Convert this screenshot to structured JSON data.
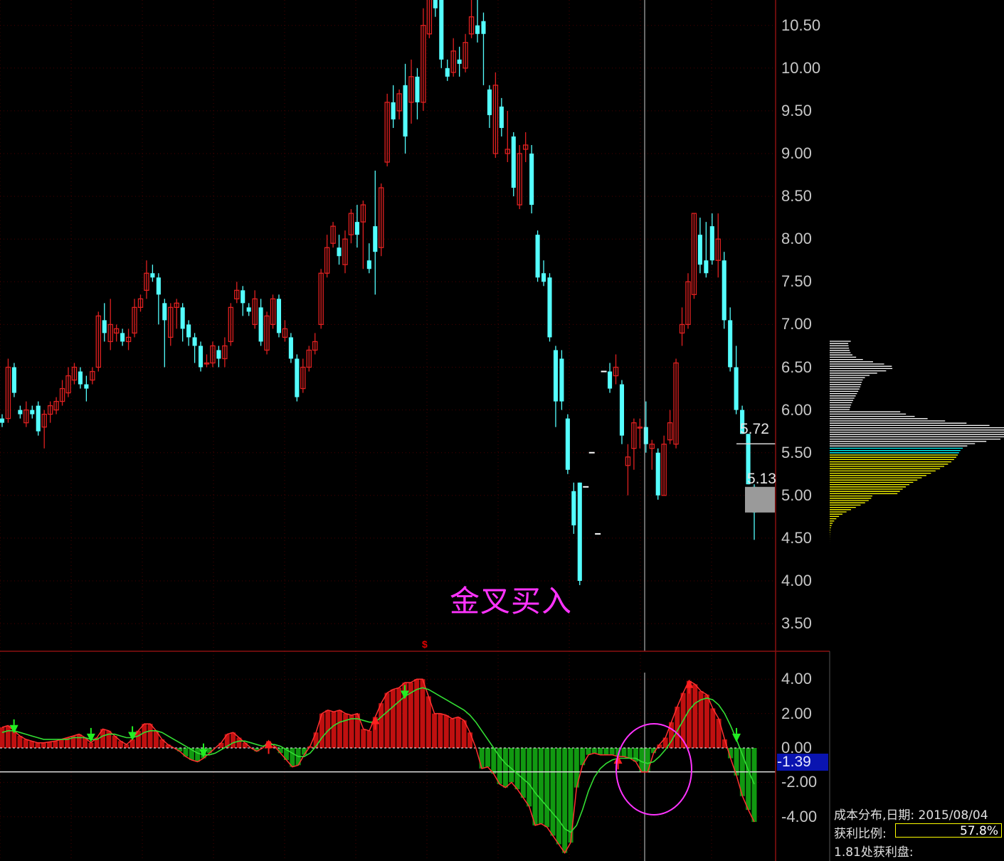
{
  "window": {
    "title": ""
  },
  "annotation": {
    "text": "金叉买入",
    "color": "#ff33ff"
  },
  "price_marker": {
    "text": "$"
  },
  "price_tags": {
    "high": "5.72",
    "last": "5.13"
  },
  "macd_current": {
    "value": "-1.39"
  },
  "cost_distribution": {
    "title": "成本分布,日期: 2015/08/04",
    "profit_label": "获利比例:",
    "profit_value": "57.8%",
    "profit_count": "1.81处获利盘:"
  },
  "colors": {
    "up": "#e02020",
    "down": "#54ffff",
    "macd_pos": "#c01010",
    "macd_neg": "#119911",
    "signal_line": "#33dd33",
    "grid": "#4a0000",
    "axis_text": "#c8c8c8"
  },
  "chart_data": [
    {
      "type": "candlestick",
      "title": "",
      "y_ticks": [
        "10.50",
        "10.00",
        "9.50",
        "9.00",
        "8.50",
        "8.00",
        "7.50",
        "7.00",
        "6.50",
        "6.00",
        "5.50",
        "5.00",
        "4.50",
        "4.00",
        "3.50"
      ],
      "ylim": [
        3.3,
        10.8
      ],
      "candles": [
        [
          5.9,
          5.85,
          5.95,
          5.8
        ],
        [
          5.9,
          6.5,
          6.6,
          5.85
        ],
        [
          6.5,
          6.2,
          6.55,
          6.15
        ],
        [
          6.0,
          5.95,
          6.05,
          5.9
        ],
        [
          5.85,
          6.0,
          6.1,
          5.8
        ],
        [
          6.0,
          5.95,
          6.05,
          5.9
        ],
        [
          6.05,
          5.75,
          6.1,
          5.7
        ],
        [
          5.8,
          5.95,
          6.0,
          5.55
        ],
        [
          5.95,
          6.05,
          6.1,
          5.85
        ],
        [
          6.0,
          6.1,
          6.15,
          5.95
        ],
        [
          6.1,
          6.25,
          6.35,
          6.05
        ],
        [
          6.2,
          6.4,
          6.5,
          6.15
        ],
        [
          6.35,
          6.5,
          6.55,
          6.3
        ],
        [
          6.45,
          6.3,
          6.5,
          6.25
        ],
        [
          6.3,
          6.25,
          6.4,
          6.1
        ],
        [
          6.35,
          6.45,
          6.5,
          6.3
        ],
        [
          6.5,
          7.1,
          7.15,
          6.45
        ],
        [
          7.05,
          6.9,
          7.25,
          6.8
        ],
        [
          6.8,
          7.0,
          7.3,
          6.7
        ],
        [
          6.9,
          6.95,
          7.0,
          6.8
        ],
        [
          6.9,
          6.8,
          6.95,
          6.75
        ],
        [
          6.8,
          6.85,
          6.95,
          6.7
        ],
        [
          6.9,
          7.2,
          7.3,
          6.85
        ],
        [
          7.2,
          7.3,
          7.35,
          7.15
        ],
        [
          7.4,
          7.6,
          7.75,
          7.3
        ],
        [
          7.6,
          7.55,
          7.7,
          7.5
        ],
        [
          7.55,
          7.35,
          7.6,
          7.0
        ],
        [
          7.25,
          7.05,
          7.3,
          6.5
        ],
        [
          6.85,
          7.2,
          7.25,
          6.75
        ],
        [
          7.2,
          7.25,
          7.3,
          6.95
        ],
        [
          7.2,
          6.95,
          7.25,
          6.8
        ],
        [
          7.0,
          6.85,
          7.05,
          6.75
        ],
        [
          6.85,
          6.75,
          6.9,
          6.55
        ],
        [
          6.75,
          6.5,
          6.8,
          6.45
        ],
        [
          6.55,
          6.55,
          6.65,
          6.5
        ],
        [
          6.55,
          6.75,
          6.8,
          6.5
        ],
        [
          6.7,
          6.6,
          6.75,
          6.5
        ],
        [
          6.6,
          6.75,
          6.85,
          6.5
        ],
        [
          6.8,
          7.2,
          7.25,
          6.75
        ],
        [
          7.3,
          7.4,
          7.5,
          7.25
        ],
        [
          7.4,
          7.25,
          7.45,
          7.1
        ],
        [
          7.2,
          7.15,
          7.25,
          7.1
        ],
        [
          7.0,
          7.3,
          7.4,
          6.95
        ],
        [
          7.2,
          6.8,
          7.3,
          6.75
        ],
        [
          6.7,
          7.1,
          7.15,
          6.65
        ],
        [
          7.0,
          7.3,
          7.35,
          6.95
        ],
        [
          7.3,
          6.9,
          7.35,
          6.85
        ],
        [
          6.85,
          6.95,
          7.05,
          6.8
        ],
        [
          6.85,
          6.6,
          6.9,
          6.55
        ],
        [
          6.6,
          6.15,
          6.65,
          6.1
        ],
        [
          6.25,
          6.5,
          6.6,
          6.2
        ],
        [
          6.5,
          6.7,
          6.75,
          6.45
        ],
        [
          6.7,
          6.8,
          6.9,
          6.65
        ],
        [
          7.0,
          7.6,
          7.65,
          6.95
        ],
        [
          7.6,
          7.9,
          8.05,
          7.55
        ],
        [
          7.95,
          8.15,
          8.2,
          7.9
        ],
        [
          7.9,
          7.8,
          8.05,
          7.7
        ],
        [
          7.7,
          8.0,
          8.1,
          7.6
        ],
        [
          8.05,
          8.3,
          8.35,
          7.95
        ],
        [
          8.2,
          8.05,
          8.4,
          7.9
        ],
        [
          8.2,
          8.4,
          8.45,
          7.65
        ],
        [
          7.75,
          7.65,
          7.95,
          7.6
        ],
        [
          8.15,
          7.85,
          8.8,
          7.35
        ],
        [
          7.9,
          8.6,
          8.65,
          7.8
        ],
        [
          8.9,
          9.6,
          9.7,
          8.85
        ],
        [
          9.6,
          9.4,
          9.8,
          9.3
        ],
        [
          9.5,
          9.7,
          9.75,
          9.4
        ],
        [
          9.8,
          9.2,
          10.05,
          9.0
        ],
        [
          9.6,
          9.9,
          10.1,
          9.35
        ],
        [
          9.9,
          9.6,
          10.0,
          9.4
        ],
        [
          9.6,
          10.5,
          10.7,
          9.5
        ],
        [
          10.4,
          11.0,
          11.1,
          10.35
        ],
        [
          10.95,
          10.7,
          11.0,
          10.6
        ],
        [
          10.9,
          10.1,
          10.95,
          10.0
        ],
        [
          10.0,
          9.9,
          10.1,
          9.85
        ],
        [
          9.95,
          10.2,
          10.35,
          9.9
        ],
        [
          10.1,
          10.05,
          10.25,
          9.9
        ],
        [
          10.0,
          10.3,
          10.4,
          9.95
        ],
        [
          10.4,
          10.6,
          10.85,
          10.35
        ],
        [
          10.5,
          10.4,
          11.0,
          10.3
        ],
        [
          10.55,
          10.4,
          10.65,
          9.8
        ],
        [
          9.75,
          9.45,
          9.8,
          9.3
        ],
        [
          9.0,
          9.8,
          9.95,
          8.95
        ],
        [
          9.55,
          9.3,
          9.65,
          9.2
        ],
        [
          9.0,
          9.05,
          9.5,
          8.9
        ],
        [
          9.2,
          8.6,
          9.25,
          8.5
        ],
        [
          8.4,
          9.0,
          9.1,
          8.35
        ],
        [
          9.05,
          9.1,
          9.25,
          8.9
        ],
        [
          9.0,
          8.4,
          9.1,
          8.3
        ],
        [
          8.05,
          7.55,
          8.1,
          7.5
        ],
        [
          7.6,
          7.5,
          7.75,
          7.45
        ],
        [
          7.55,
          6.85,
          7.6,
          6.8
        ],
        [
          6.7,
          6.1,
          6.75,
          5.8
        ],
        [
          6.6,
          6.1,
          6.7,
          6.0
        ],
        [
          5.9,
          5.3,
          5.95,
          5.25
        ],
        [
          5.05,
          4.65,
          5.15,
          4.55
        ],
        [
          5.15,
          4.0,
          5.15,
          3.95
        ],
        [
          5.1,
          5.1,
          5.1,
          5.1
        ],
        [
          5.5,
          5.5,
          5.5,
          5.5
        ],
        [
          4.55,
          4.55,
          4.55,
          4.55
        ],
        [
          6.45,
          6.45,
          6.45,
          6.45
        ],
        [
          6.45,
          6.25,
          6.55,
          6.2
        ],
        [
          6.4,
          6.5,
          6.65,
          6.3
        ],
        [
          6.3,
          5.7,
          6.35,
          5.6
        ],
        [
          5.35,
          5.45,
          5.6,
          5.0
        ],
        [
          5.55,
          5.85,
          5.9,
          5.3
        ],
        [
          5.8,
          5.8,
          5.9,
          5.55
        ],
        [
          5.8,
          5.6,
          6.1,
          5.5
        ],
        [
          5.55,
          5.6,
          5.65,
          5.3
        ],
        [
          5.5,
          5.0,
          5.55,
          4.95
        ],
        [
          5.0,
          5.6,
          5.7,
          5.0
        ],
        [
          5.65,
          5.85,
          6.0,
          5.6
        ],
        [
          5.6,
          6.55,
          6.6,
          5.55
        ],
        [
          6.9,
          7.0,
          7.2,
          6.75
        ],
        [
          7.0,
          7.5,
          7.6,
          6.95
        ],
        [
          7.35,
          8.3,
          8.3,
          7.3
        ],
        [
          8.05,
          7.7,
          8.25,
          7.6
        ],
        [
          7.75,
          7.6,
          8.2,
          7.55
        ],
        [
          8.15,
          7.75,
          8.3,
          7.7
        ],
        [
          7.75,
          8.0,
          8.3,
          7.55
        ],
        [
          7.75,
          7.05,
          7.85,
          6.95
        ],
        [
          7.05,
          6.5,
          7.2,
          6.45
        ],
        [
          6.5,
          6.0,
          6.75,
          5.95
        ],
        [
          6.0,
          5.72,
          6.05,
          5.72
        ],
        [
          5.72,
          5.13,
          5.72,
          5.13
        ],
        [
          5.1,
          4.8,
          5.13,
          4.48
        ]
      ],
      "current_price": 5.13,
      "recent_high": 5.72
    },
    {
      "type": "bar",
      "title": "",
      "y_ticks": [
        "4.00",
        "2.00",
        "0.00",
        "-2.00",
        "-4.00"
      ],
      "ylim": [
        -6.3,
        4.6
      ],
      "reference_value": -1.39,
      "values": [
        1.2,
        1.3,
        1.0,
        0.7,
        0.5,
        0.4,
        0.3,
        0.3,
        0.35,
        0.4,
        0.5,
        0.6,
        0.7,
        0.8,
        0.6,
        0.3,
        0.6,
        1.1,
        1.0,
        0.7,
        0.4,
        0.2,
        0.5,
        1.0,
        1.4,
        1.4,
        1.0,
        0.5,
        0.2,
        0.0,
        -0.2,
        -0.5,
        -0.7,
        -0.8,
        -0.6,
        -0.3,
        0.0,
        0.3,
        0.8,
        0.9,
        0.6,
        0.3,
        0.0,
        -0.2,
        0.0,
        0.4,
        0.1,
        -0.3,
        -0.7,
        -1.1,
        -1.0,
        -0.4,
        0.1,
        0.9,
        2.0,
        2.2,
        2.1,
        2.2,
        2.0,
        1.9,
        2.0,
        1.1,
        1.0,
        1.8,
        2.6,
        3.2,
        3.4,
        3.5,
        3.8,
        3.8,
        4.0,
        4.0,
        3.0,
        2.0,
        2.0,
        1.9,
        1.7,
        1.8,
        1.6,
        0.9,
        0.0,
        -1.2,
        -1.1,
        -1.5,
        -2.1,
        -2.3,
        -2.0,
        -2.4,
        -2.9,
        -3.4,
        -4.5,
        -4.4,
        -4.6,
        -5.1,
        -5.6,
        -6.1,
        -5.5,
        -2.3,
        -1.0,
        -0.4,
        -0.3,
        -0.4,
        -0.4,
        -0.4,
        -0.5,
        -0.5,
        -0.6,
        -0.8,
        -1.4,
        -1.4,
        -0.3,
        0.2,
        0.6,
        1.5,
        2.4,
        3.2,
        3.9,
        3.7,
        3.3,
        3.1,
        2.3,
        1.7,
        0.5,
        -0.6,
        -1.6,
        -2.8,
        -3.6,
        -4.3
      ],
      "signal": [
        0.9,
        1.0,
        1.0,
        0.9,
        0.8,
        0.7,
        0.6,
        0.5,
        0.5,
        0.5,
        0.5,
        0.5,
        0.6,
        0.6,
        0.6,
        0.5,
        0.5,
        0.7,
        0.8,
        0.8,
        0.7,
        0.6,
        0.6,
        0.7,
        0.9,
        1.0,
        1.0,
        0.9,
        0.7,
        0.5,
        0.3,
        0.1,
        -0.1,
        -0.3,
        -0.4,
        -0.4,
        -0.3,
        -0.1,
        0.1,
        0.3,
        0.4,
        0.4,
        0.3,
        0.2,
        0.1,
        0.2,
        0.2,
        0.1,
        -0.1,
        -0.3,
        -0.5,
        -0.5,
        -0.3,
        0.1,
        0.6,
        1.0,
        1.3,
        1.5,
        1.6,
        1.7,
        1.7,
        1.6,
        1.5,
        1.5,
        1.8,
        2.1,
        2.4,
        2.7,
        3.0,
        3.2,
        3.4,
        3.5,
        3.4,
        3.2,
        3.0,
        2.8,
        2.6,
        2.4,
        2.2,
        1.9,
        1.5,
        1.0,
        0.5,
        0.0,
        -0.5,
        -0.9,
        -1.2,
        -1.5,
        -1.8,
        -2.1,
        -2.6,
        -3.0,
        -3.4,
        -3.8,
        -4.2,
        -4.7,
        -4.9,
        -4.5,
        -3.6,
        -2.5,
        -1.7,
        -1.2,
        -0.9,
        -0.7,
        -0.6,
        -0.6,
        -0.6,
        -0.6,
        -0.8,
        -0.9,
        -0.8,
        -0.5,
        -0.1,
        0.4,
        1.0,
        1.6,
        2.2,
        2.6,
        2.8,
        2.9,
        2.8,
        2.5,
        2.0,
        1.3,
        0.5,
        -0.4,
        -1.3,
        -2.1
      ],
      "down_arrows_at": [
        2,
        15,
        22,
        34,
        68,
        124
      ],
      "up_arrows_at": [
        45,
        63,
        104,
        116
      ]
    }
  ]
}
